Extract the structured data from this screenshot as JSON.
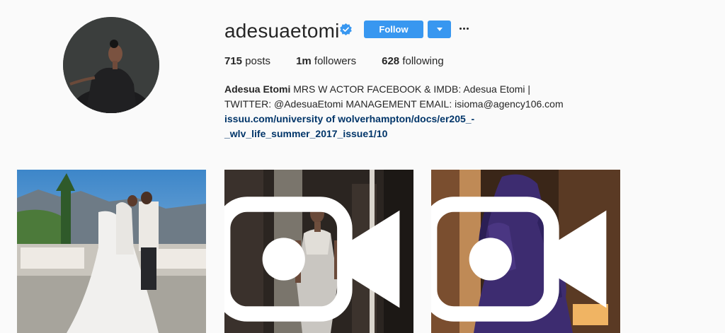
{
  "profile": {
    "username": "adesuaetomi",
    "verified": true,
    "follow_label": "Follow",
    "stats": {
      "posts_count": "715",
      "posts_label": "posts",
      "followers_count": "1m",
      "followers_label": "followers",
      "following_count": "628",
      "following_label": "following"
    },
    "bio": {
      "name": "Adesua Etomi",
      "text": " MRS W ACTOR FACEBOOK & IMDB: Adesua Etomi | TWITTER: @AdesuaEtomi MANAGEMENT EMAIL: isioma@agency106.com",
      "link_line1": "issuu.com/university of wolverhampton/docs/er205_-",
      "link_line2": "_wlv_life_summer_2017_issue1/10"
    }
  },
  "posts": [
    {
      "type": "photo",
      "icon": null
    },
    {
      "type": "video",
      "icon": "video-camera-icon"
    },
    {
      "type": "video",
      "icon": "video-camera-icon"
    }
  ],
  "colors": {
    "accent": "#3897f0",
    "link": "#003569",
    "background": "#fafafa",
    "text": "#262626"
  }
}
